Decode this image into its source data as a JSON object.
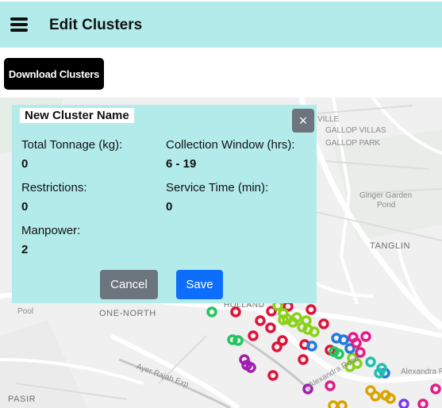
{
  "header": {
    "title": "Edit Clusters",
    "menu_icon": "hamburger-menu-icon"
  },
  "toolbar": {
    "download_label": "Download Clusters"
  },
  "map": {
    "labels": [
      "VILLE",
      "GALLOP VILLAS",
      "GALLOP PARK",
      "Ginger Garden",
      "Pond",
      "TANGLIN",
      "ONE-NORTH",
      "PASIR",
      "Alexandra Rd",
      "Pool",
      "Ayer Rajah Exp",
      "Alexandra Road",
      "HOLLAND"
    ],
    "marker_colors": [
      "#dc143c",
      "#22c55e",
      "#8bd11a",
      "#1f7ae0",
      "#a21caf",
      "#e11d8a",
      "#c9b000",
      "#d9a400",
      "#20c0b0",
      "#7c3aed"
    ]
  },
  "modal": {
    "title": "New Cluster Name",
    "close_label": "×",
    "total_tonnage_label": "Total Tonnage (kg):",
    "total_tonnage_value": "0",
    "collection_window_label": "Collection Window (hrs):",
    "collection_window_value": "6 - 19",
    "restrictions_label": "Restrictions:",
    "restrictions_value": "0",
    "service_time_label": "Service Time (min):",
    "service_time_value": "0",
    "manpower_label": "Manpower:",
    "manpower_value": "2",
    "cancel_label": "Cancel",
    "save_label": "Save"
  }
}
